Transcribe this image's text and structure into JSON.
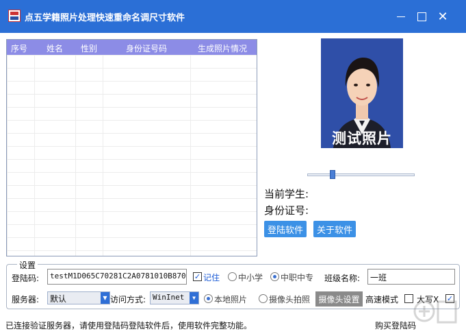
{
  "window": {
    "title": "点五学籍照片处理快速重命名调尺寸软件",
    "minimize_label": "",
    "maximize_label": "",
    "close_label": "✕"
  },
  "table": {
    "columns": [
      "序号",
      "姓名",
      "性别",
      "身份证号码",
      "生成照片情况"
    ],
    "rows": []
  },
  "photo": {
    "overlay_text": "测试照片"
  },
  "slider": {
    "value": 0.22
  },
  "info": {
    "current_student_label": "当前学生:",
    "id_number_label": "身份证号:"
  },
  "actions": {
    "login_label": "登陆软件",
    "about_label": "关于软件"
  },
  "settings": {
    "group_title": "设置",
    "login_code_label": "登陆码:",
    "login_code_value": "testM1D065C70281C2A0781010B87024",
    "remember_label": "记住",
    "remember_checked": true,
    "school_type_options": [
      "中小学",
      "中职中专"
    ],
    "school_type_selected": "中职中专",
    "class_name_label": "班级名称:",
    "class_name_value": "一班",
    "server_label": "服务器:",
    "server_value": "默认",
    "access_mode_label": "访问方式:",
    "access_mode_value": "WinInet",
    "photo_source_options": [
      "本地照片",
      "摄像头拍照"
    ],
    "photo_source_selected": "本地照片",
    "camera_settings_label": "摄像头设置",
    "hs_mode_label": "高速模式",
    "hs_mode_checked": false,
    "uppercase_x_label": "大写X",
    "uppercase_x_checked": true
  },
  "status": {
    "message": "已连接验证服务器，请使用登陆码登陆软件后，使用软件完整功能。",
    "buy_link": "购买登陆码"
  },
  "colors": {
    "titlebar": "#2b6fd6",
    "table_header": "#8c8ce6",
    "primary_button": "#3c91e6",
    "photo_background": "#2f4fa8"
  }
}
